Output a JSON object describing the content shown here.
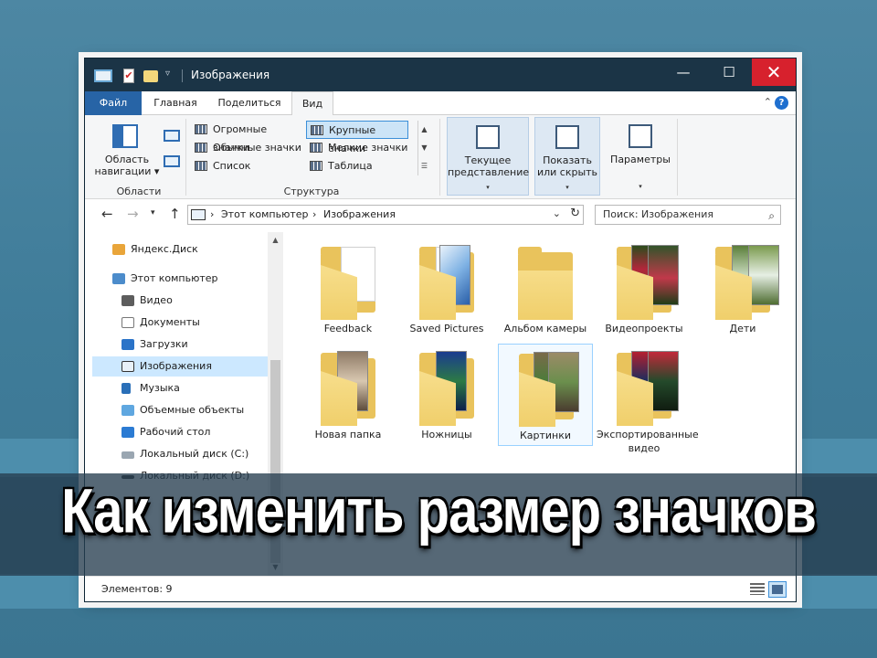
{
  "window": {
    "title": "Изображения",
    "controls": {
      "minimize": "—",
      "maximize": "☐",
      "close": "✕"
    }
  },
  "tabs": [
    {
      "label": "Файл"
    },
    {
      "label": "Главная"
    },
    {
      "label": "Поделиться"
    },
    {
      "label": "Вид"
    }
  ],
  "ribbon": {
    "panes": {
      "nav_pane_label": "Область навигации",
      "group_label": "Области"
    },
    "layout": {
      "items": [
        {
          "label": "Огромные значки"
        },
        {
          "label": "Крупные значки"
        },
        {
          "label": "Обычные значки"
        },
        {
          "label": "Мелкие значки"
        },
        {
          "label": "Список"
        },
        {
          "label": "Таблица"
        }
      ],
      "selected": "Крупные значки",
      "group_label": "Структура"
    },
    "current_view_label": "Текущее представление",
    "show_hide_label": "Показать или скрыть",
    "options_label": "Параметры"
  },
  "address": {
    "crumbs": [
      "Этот компьютер",
      "Изображения"
    ],
    "search_placeholder": "Поиск: Изображения"
  },
  "nav": {
    "items": [
      {
        "label": "Яндекс.Диск",
        "icon": "yandex-disk-icon"
      },
      {
        "label": "Этот компьютер",
        "icon": "computer-icon"
      },
      {
        "label": "Видео",
        "icon": "video-icon"
      },
      {
        "label": "Документы",
        "icon": "documents-icon"
      },
      {
        "label": "Загрузки",
        "icon": "downloads-icon"
      },
      {
        "label": "Изображения",
        "icon": "pictures-icon",
        "selected": true
      },
      {
        "label": "Музыка",
        "icon": "music-icon"
      },
      {
        "label": "Объемные объекты",
        "icon": "3d-objects-icon"
      },
      {
        "label": "Рабочий стол",
        "icon": "desktop-icon"
      },
      {
        "label": "Локальный диск (C:)",
        "icon": "drive-c-icon"
      },
      {
        "label": "Локальный диск (D:)",
        "icon": "drive-d-icon"
      }
    ]
  },
  "folders": [
    {
      "label": "Feedback"
    },
    {
      "label": "Saved Pictures"
    },
    {
      "label": "Альбом камеры"
    },
    {
      "label": "Видеопроекты"
    },
    {
      "label": "Дети"
    },
    {
      "label": "Новая папка"
    },
    {
      "label": "Ножницы"
    },
    {
      "label": "Картинки",
      "selected": true
    },
    {
      "label": "Экспортированные видео"
    }
  ],
  "status": {
    "items_count": "Элементов: 9"
  },
  "banner": {
    "text": "Как изменить размер значков"
  }
}
